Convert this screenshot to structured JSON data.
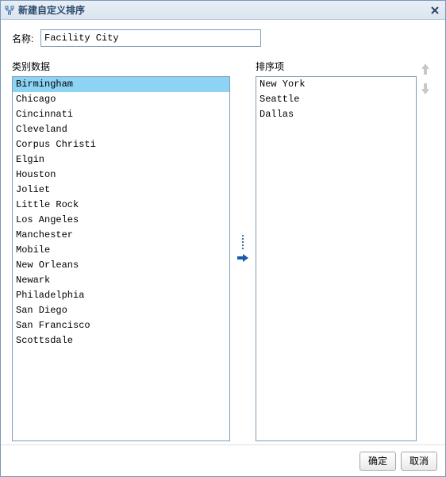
{
  "titlebar": {
    "title": "新建自定义排序"
  },
  "name": {
    "label": "名称:",
    "value": "Facility City"
  },
  "category": {
    "label": "类别数据",
    "items": [
      "Birmingham",
      "Chicago",
      "Cincinnati",
      "Cleveland",
      "Corpus Christi",
      "Elgin",
      "Houston",
      "Joliet",
      "Little Rock",
      "Los Angeles",
      "Manchester",
      "Mobile",
      "New Orleans",
      "Newark",
      "Philadelphia",
      "San Diego",
      "San Francisco",
      "Scottsdale"
    ],
    "selected_index": 0
  },
  "sort": {
    "label": "排序项",
    "items": [
      "New York",
      "Seattle",
      "Dallas"
    ]
  },
  "buttons": {
    "ok": "确定",
    "cancel": "取消"
  }
}
